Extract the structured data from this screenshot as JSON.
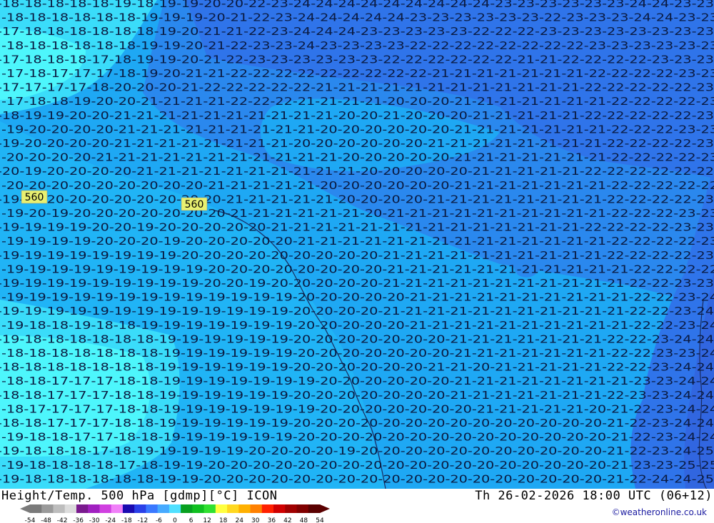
{
  "title": {
    "left": "Height/Temp. 500 hPa [gdmp][°C] ICON",
    "right": "Th 26-02-2026 18:00 UTC (06+12)"
  },
  "credit": "©weatheronline.co.uk",
  "height_labels": [
    "560",
    "560"
  ],
  "colorbar": {
    "ticks": [
      "-54",
      "-48",
      "-42",
      "-36",
      "-30",
      "-24",
      "-18",
      "-12",
      "-6",
      "0",
      "6",
      "12",
      "18",
      "24",
      "30",
      "36",
      "42",
      "48",
      "54"
    ],
    "colors": [
      "#7a7a7a",
      "#9a9a9a",
      "#bdbdbd",
      "#dcdcdc",
      "#7a1a8e",
      "#a020c0",
      "#d040e0",
      "#f080f8",
      "#1a0ab0",
      "#2a40e8",
      "#3a78ff",
      "#46aaff",
      "#50e0ff",
      "#08a020",
      "#10c020",
      "#30e030",
      "#ffff40",
      "#ffd820",
      "#ffb000",
      "#ff8000",
      "#ff2000",
      "#d00000",
      "#a00000",
      "#800000",
      "#5a0000"
    ]
  },
  "field_colors": {
    "t17": "#4df6fc",
    "t18": "#3adcfa",
    "t19": "#20b4f6",
    "t20": "#1ea8f4",
    "t21": "#2a88ee",
    "t22": "#2f74ea",
    "t23": "#2f74ea",
    "t24": "#2f74ea"
  },
  "temperature_rows": [
    "-18-18-18-18-18-19-18-19-19-20-20-22-23-24-24-24-24-24-24-24-24-24-23-23-23-23-23-23-24-24-23-23",
    "-18-18-18-18-18-18-19-19-19-20-21-22-23-24-24-24-24-24-23-23-23-23-23-23-22-23-23-23-24-24-23-23",
    "-17-18-18-18-18-18-18-19-20-21-21-22-23-24-24-24-23-23-23-23-23-22-22-22-23-23-23-23-23-23-23-23",
    "-18-18-18-18-18-18-19-19-20-21-22-23-23-24-23-23-23-23-22-22-22-22-22-22-22-22-23-23-23-23-23-23",
    "-17-18-18-18-17-18-19-19-20-21-22-23-23-23-23-23-23-22-22-22-22-22-22-21-21-22-22-22-22-23-23-23",
    "-17-18-17-17-17-18-19-20-21-21-22-22-22-22-22-22-22-22-22-21-21-21-21-21-21-21-22-22-22-22-23-23",
    "-17-17-17-17-18-20-20-20-21-22-22-22-22-22-21-21-21-21-21-21-21-21-21-21-21-21-22-22-22-22-22-23",
    "-17-18-18-19-20-20-21-21-21-21-22-22-22-21-21-21-21-20-20-20-21-21-21-21-21-21-21-22-22-22-22-23",
    "-18-19-19-20-20-21-21-21-21-21-21-21-21-21-21-20-20-21-20-20-20-21-21-21-21-21-22-22-22-22-22-23",
    "-19-20-20-20-20-21-21-21-21-21-21-21-21-21-20-20-20-20-20-20-21-21-21-21-21-21-21-22-22-22-23-23",
    "-19-20-20-20-20-21-21-21-21-21-21-21-21-20-20-20-20-20-20-21-21-21-21-21-21-21-21-22-22-22-22-23",
    "-20-20-20-20-21-21-21-21-21-21-21-21-21-21-21-20-20-20-20-20-21-21-21-21-21-21-21-22-22-22-22-23",
    "-20-19-20-20-20-20-21-21-21-21-21-21-21-21-21-21-20-20-20-20-20-21-21-21-21-21-22-22-22-22-22-22",
    "-20-20-20-20-20-20-20-20-20-21-21-21-21-21-20-20-20-20-20-20-21-21-21-21-21-21-21-22-22-22-22-22",
    "-19-20-20-20-20-20-20-20-20-20-21-21-21-21-21-20-20-20-20-21-21-21-21-21-21-21-21-22-22-22-22-23",
    "-19-20-19-20-20-20-20-20-20-20-21-21-21-21-21-21-20-21-21-21-21-21-21-21-21-21-21-22-22-22-23-23",
    "-19-19-19-19-20-20-19-20-20-20-20-20-21-21-21-21-21-21-21-21-21-21-21-21-21-21-22-22-22-22-23-23",
    "-19-19-19-19-20-20-20-19-20-20-20-20-20-21-21-21-21-21-21-21-21-21-21-21-21-21-21-22-22-22-22-23",
    "-19-19-19-19-19-19-19-19-20-20-20-20-20-20-20-20-20-21-21-21-21-21-21-21-21-21-21-22-22-22-22-23",
    "-19-19-19-19-19-19-19-19-19-20-20-20-20-20-20-20-20-21-21-21-21-21-21-21-21-21-21-21-22-22-22-22",
    "-19-19-19-19-19-19-19-19-19-20-20-19-20-20-20-20-20-21-21-21-21-21-21-21-21-21-21-21-22-22-23-23",
    "-19-19-19-19-19-19-19-19-19-19-19-19-19-20-20-20-20-20-21-21-21-21-21-21-21-21-21-21-22-22-23-24",
    "-19-19-19-19-19-19-19-19-19-19-19-19-19-20-20-20-20-21-21-21-21-21-21-21-21-21-21-21-22-22-23-24",
    "-19-18-18-19-18-18-19-19-19-19-19-19-19-20-20-20-20-20-21-21-21-21-21-21-21-21-21-21-22-22-23-24",
    "-19-18-18-18-18-18-18-19-19-19-19-19-19-20-20-20-20-20-20-20-21-21-21-21-21-21-21-22-22-23-24-24",
    "-18-18-18-18-18-18-18-19-19-19-19-19-19-20-20-20-20-20-20-20-21-21-21-21-21-21-21-22-22-23-23-24",
    "-18-18-18-18-18-18-18-19-19-19-19-19-19-20-20-20-20-20-20-21-21-20-21-21-21-21-21-22-22-23-24-24",
    "-18-18-17-17-17-18-18-19-19-19-19-19-19-19-20-20-20-20-20-20-21-21-21-21-21-21-21-21-23-23-24-24",
    "-18-18-17-17-17-18-18-19-19-19-19-19-19-20-20-20-20-20-20-20-21-21-21-21-21-21-21-22-23-23-24-24",
    "-18-17-17-17-17-18-18-19-19-19-19-19-19-19-20-20-20-20-20-20-20-21-21-21-21-21-20-21-22-23-24-24",
    "-18-18-17-17-17-18-18-19-19-19-19-19-19-20-20-20-20-20-20-20-20-20-20-20-20-20-20-21-22-23-24-24",
    "-19-18-18-17-17-18-18-19-19-19-19-19-19-20-20-20-20-20-20-20-20-20-20-20-20-20-20-21-22-23-24-24",
    "-19-18-18-18-17-18-19-19-19-19-19-20-20-20-20-19-20-20-20-20-20-20-20-20-20-20-20-21-22-23-24-25",
    "-19-18-18-18-18-17-18-19-19-20-20-20-20-20-20-20-20-20-20-20-20-20-20-20-20-20-20-21-23-23-25-25",
    "-19-18-18-18-18-18-18-19-19-20-20-20-20-20-20-20-20-20-20-20-20-20-20-20-20-20-20-21-22-24-24-25"
  ]
}
